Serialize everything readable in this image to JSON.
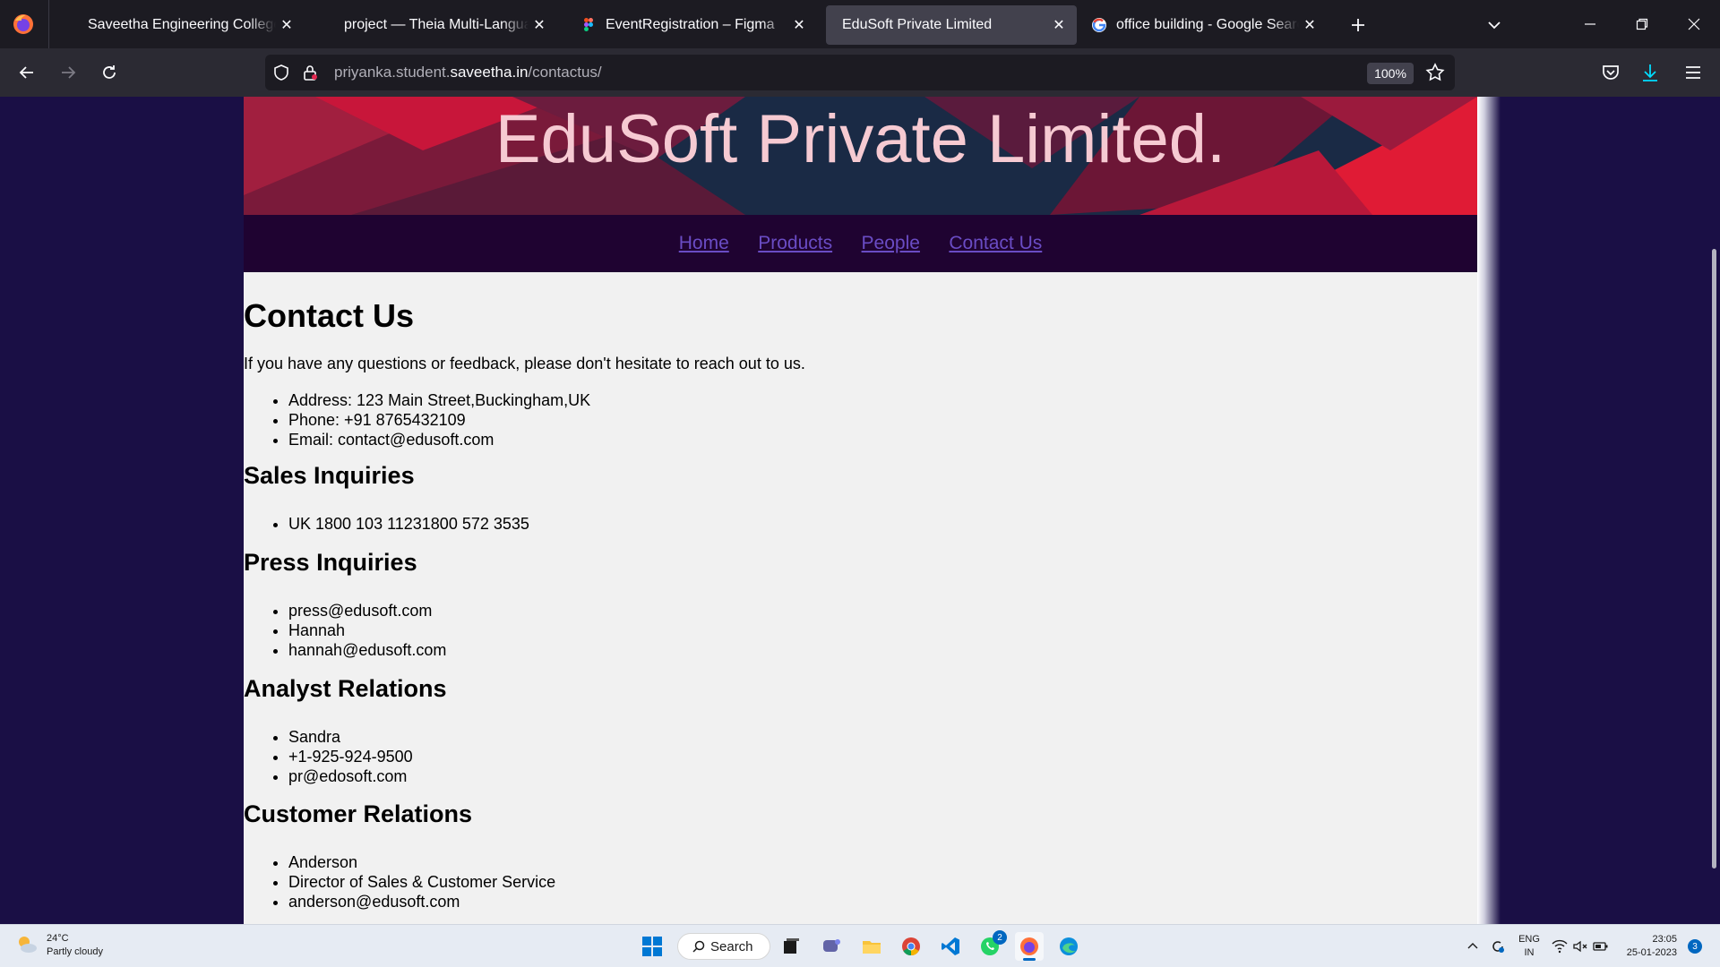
{
  "browser": {
    "tabs": [
      {
        "label": "Saveetha Engineering College",
        "icon": "tab-favicon-blank"
      },
      {
        "label": "project — Theia Multi-Language Exa",
        "icon": "tab-favicon-blank"
      },
      {
        "label": "EventRegistration – Figma",
        "icon": "figma-icon"
      },
      {
        "label": "EduSoft Private Limited",
        "icon": "tab-favicon-blank",
        "active": true
      },
      {
        "label": "office building - Google Search",
        "icon": "google-icon"
      }
    ],
    "url_path_prefix": "priyanka.student.",
    "url_host": "saveetha.in",
    "url_path": "/contactus/",
    "zoom": "100%"
  },
  "site": {
    "title": "EduSoft Private Limited.",
    "nav": [
      "Home",
      "Products",
      "People",
      "Contact Us"
    ]
  },
  "contact": {
    "heading": "Contact Us",
    "intro": "If you have any questions or feedback, please don't hesitate to reach out to us.",
    "details": [
      "Address: 123 Main Street,Buckingham,UK",
      "Phone: +91 8765432109",
      "Email: contact@edusoft.com"
    ],
    "sections": [
      {
        "heading": "Sales Inquiries",
        "items": [
          "UK 1800 103 11231800 572 3535"
        ]
      },
      {
        "heading": "Press Inquiries",
        "items": [
          "press@edusoft.com",
          "Hannah",
          "hannah@edusoft.com"
        ]
      },
      {
        "heading": "Analyst Relations",
        "items": [
          "Sandra",
          "+1-925-924-9500",
          "pr@edosoft.com"
        ]
      },
      {
        "heading": "Customer Relations",
        "items": [
          "Anderson",
          "Director of Sales & Customer Service",
          "anderson@edusoft.com"
        ]
      }
    ]
  },
  "taskbar": {
    "weather_temp": "24°C",
    "weather_desc": "Partly cloudy",
    "search_label": "Search",
    "whatsapp_badge": "2",
    "lang_top": "ENG",
    "lang_bottom": "IN",
    "time": "23:05",
    "date": "25-01-2023",
    "notification_count": "3"
  },
  "colors": {
    "page_bg": "#1a0f45",
    "menu_bg": "#1f0331",
    "link": "#6a4cc4",
    "banner_title": "#f6cad2"
  }
}
